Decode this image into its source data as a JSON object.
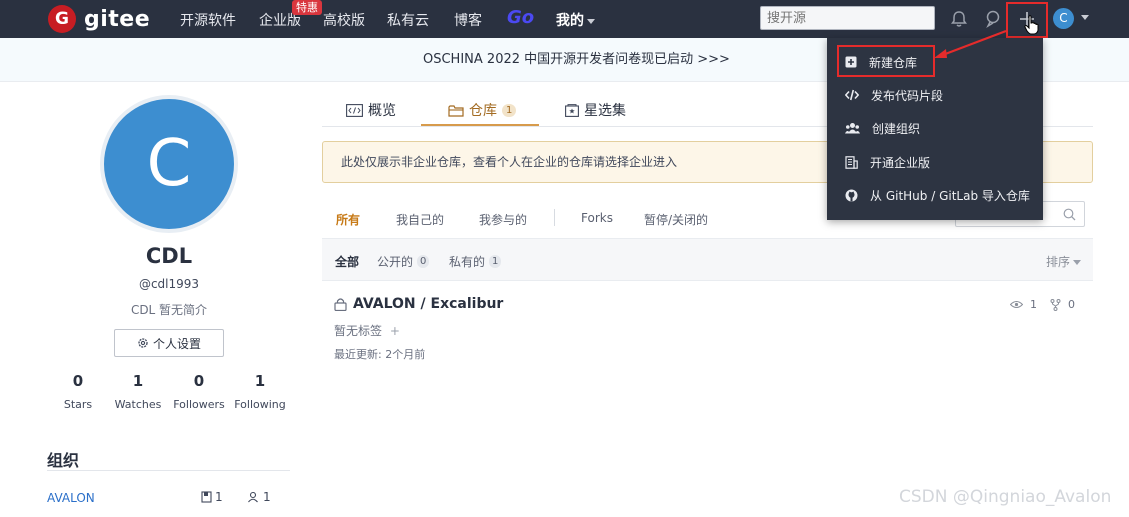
{
  "topnav": {
    "logo_mark": "G",
    "logo_text": "gitee",
    "items": [
      "开源软件",
      "企业版",
      "高校版",
      "私有云",
      "博客"
    ],
    "enterprise_badge": "特惠",
    "go_label": "Go",
    "mine_label": "我的",
    "search_placeholder": "搜开源",
    "avatar_letter": "C"
  },
  "banner": {
    "text": "OSCHINA 2022 中国开源开发者问卷现已启动 >>>"
  },
  "profile": {
    "avatar_letter": "C",
    "name": "CDL",
    "handle": "@cdl1993",
    "bio": "CDL 暂无简介",
    "settings_label": "个人设置",
    "stats": [
      {
        "value": "0",
        "label": "Stars"
      },
      {
        "value": "1",
        "label": "Watches"
      },
      {
        "value": "0",
        "label": "Followers"
      },
      {
        "value": "1",
        "label": "Following"
      }
    ],
    "org_title": "组织",
    "org": {
      "name": "AVALON",
      "repos": "1",
      "members": "1"
    }
  },
  "tabs": [
    {
      "label": "概览"
    },
    {
      "label": "仓库",
      "count": "1"
    },
    {
      "label": "星选集"
    }
  ],
  "notice": "此处仅展示非企业仓库，查看个人在企业的仓库请选择企业进入",
  "filters": [
    "所有",
    "我自己的",
    "我参与的",
    "Forks",
    "暂停/关闭的"
  ],
  "sub_filters": [
    {
      "label": "全部"
    },
    {
      "label": "公开的",
      "count": "0"
    },
    {
      "label": "私有的",
      "count": "1"
    }
  ],
  "sort_label": "排序",
  "repo": {
    "title": "AVALON / Excalibur",
    "tag_text": "暂无标签",
    "tag_add": "+",
    "updated": "最近更新: 2个月前",
    "watch_count": "1",
    "fork_count": "0"
  },
  "dropdown": {
    "items": [
      "新建仓库",
      "发布代码片段",
      "创建组织",
      "开通企业版",
      "从 GitHub / GitLab 导入仓库"
    ]
  },
  "watermark": "CSDN @Qingniao_Avalon",
  "colors": {
    "nav_bg": "#2a3140",
    "brand_red": "#c71d23",
    "highlight_red": "#e52b2b",
    "accent_orange": "#c77a17",
    "avatar_blue": "#3d8ed0"
  }
}
